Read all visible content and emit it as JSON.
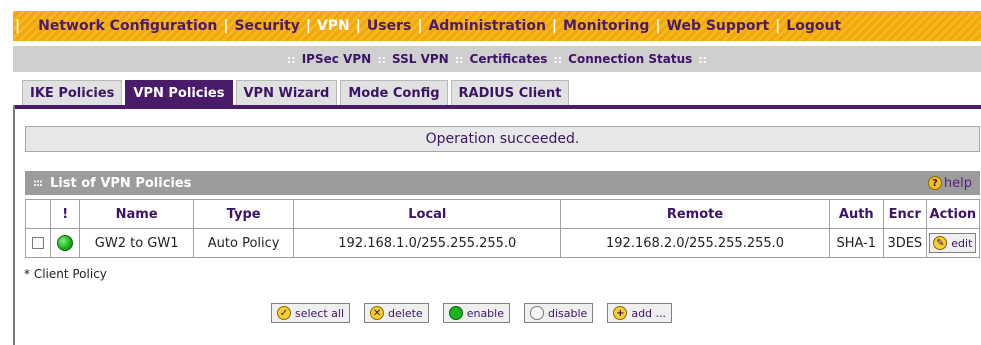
{
  "topnav": {
    "items": [
      {
        "label": "Network Configuration",
        "active": false
      },
      {
        "label": "Security",
        "active": false
      },
      {
        "label": "VPN",
        "active": true
      },
      {
        "label": "Users",
        "active": false
      },
      {
        "label": "Administration",
        "active": false
      },
      {
        "label": "Monitoring",
        "active": false
      },
      {
        "label": "Web Support",
        "active": false
      },
      {
        "label": "Logout",
        "active": false
      }
    ]
  },
  "subnav": {
    "items": [
      {
        "label": "IPSec VPN"
      },
      {
        "label": "SSL VPN"
      },
      {
        "label": "Certificates"
      },
      {
        "label": "Connection Status"
      }
    ],
    "separator": "::"
  },
  "tabs": [
    {
      "label": "IKE Policies",
      "active": false
    },
    {
      "label": "VPN Policies",
      "active": true
    },
    {
      "label": "VPN Wizard",
      "active": false
    },
    {
      "label": "Mode Config",
      "active": false
    },
    {
      "label": "RADIUS Client",
      "active": false
    }
  ],
  "message": "Operation succeeded.",
  "list": {
    "title": "List of VPN Policies",
    "help_label": "help",
    "help_glyph": "?",
    "grip": ":::",
    "columns": [
      "",
      "!",
      "Name",
      "Type",
      "Local",
      "Remote",
      "Auth",
      "Encr",
      "Action"
    ],
    "rows": [
      {
        "status": "enabled",
        "name": "GW2 to GW1",
        "type": "Auto Policy",
        "local": "192.168.1.0/255.255.255.0",
        "remote": "192.168.2.0/255.255.255.0",
        "auth": "SHA-1",
        "encr": "3DES",
        "action_label": "edit"
      }
    ]
  },
  "client_note": "* Client Policy",
  "buttons": {
    "select_all": "select all",
    "delete": "delete",
    "enable": "enable",
    "disable": "disable",
    "add": "add ..."
  },
  "colors": {
    "accent": "#4a1a6b",
    "nav_orange": "#f6b61d",
    "status_green": "#1cb31c"
  }
}
